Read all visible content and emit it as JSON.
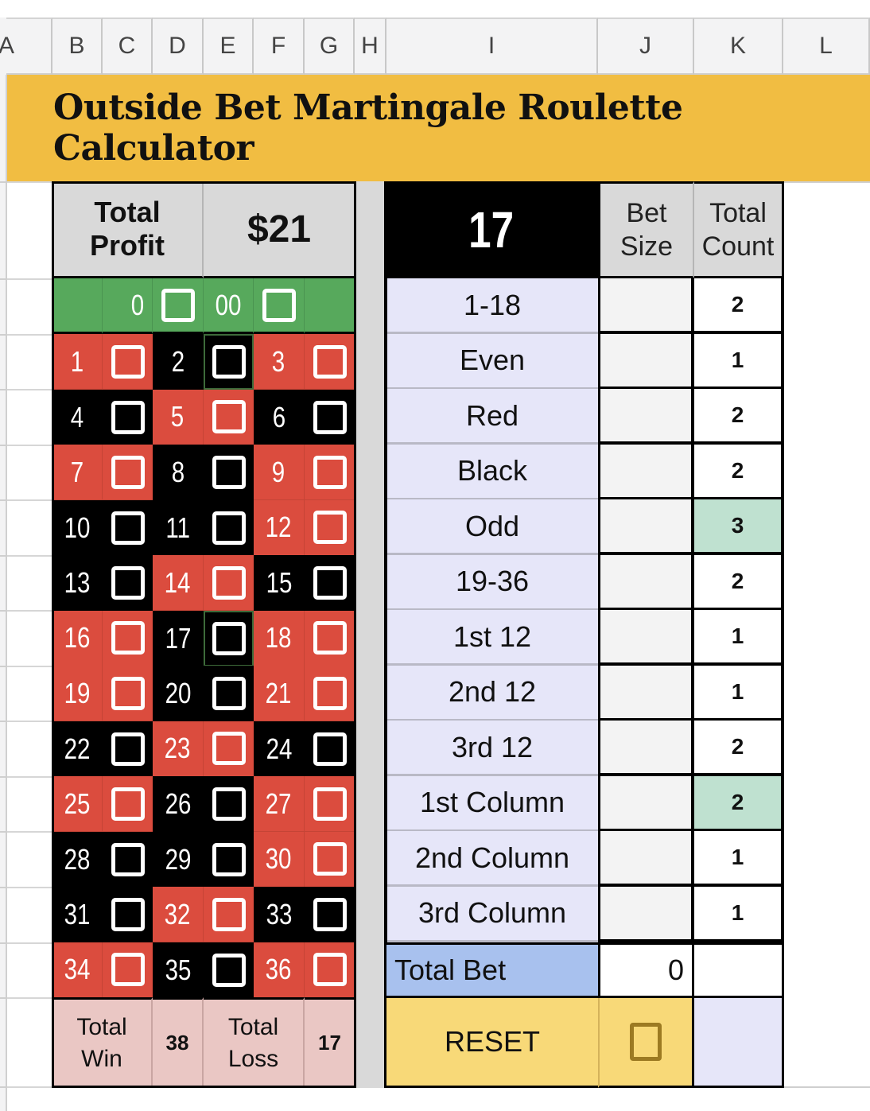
{
  "sheet": {
    "columns": [
      "A",
      "B",
      "C",
      "D",
      "E",
      "F",
      "G",
      "H",
      "I",
      "J",
      "K",
      "L"
    ]
  },
  "title": "Outside Bet Martingale Roulette Calculator",
  "profit": {
    "label": "Total Profit",
    "value": "$21"
  },
  "last_number": "17",
  "headers": {
    "bet_size": "Bet Size",
    "total_count": "Total Count"
  },
  "zero_row": {
    "zero": "0",
    "double_zero": "00"
  },
  "numbers": [
    {
      "n": "1",
      "color": "red"
    },
    {
      "n": "2",
      "color": "black"
    },
    {
      "n": "3",
      "color": "red"
    },
    {
      "n": "4",
      "color": "black"
    },
    {
      "n": "5",
      "color": "red"
    },
    {
      "n": "6",
      "color": "black"
    },
    {
      "n": "7",
      "color": "red"
    },
    {
      "n": "8",
      "color": "black"
    },
    {
      "n": "9",
      "color": "red"
    },
    {
      "n": "10",
      "color": "black"
    },
    {
      "n": "11",
      "color": "black"
    },
    {
      "n": "12",
      "color": "red"
    },
    {
      "n": "13",
      "color": "black"
    },
    {
      "n": "14",
      "color": "red"
    },
    {
      "n": "15",
      "color": "black"
    },
    {
      "n": "16",
      "color": "red"
    },
    {
      "n": "17",
      "color": "black"
    },
    {
      "n": "18",
      "color": "red"
    },
    {
      "n": "19",
      "color": "red"
    },
    {
      "n": "20",
      "color": "black"
    },
    {
      "n": "21",
      "color": "red"
    },
    {
      "n": "22",
      "color": "black"
    },
    {
      "n": "23",
      "color": "red"
    },
    {
      "n": "24",
      "color": "black"
    },
    {
      "n": "25",
      "color": "red"
    },
    {
      "n": "26",
      "color": "black"
    },
    {
      "n": "27",
      "color": "red"
    },
    {
      "n": "28",
      "color": "black"
    },
    {
      "n": "29",
      "color": "black"
    },
    {
      "n": "30",
      "color": "red"
    },
    {
      "n": "31",
      "color": "black"
    },
    {
      "n": "32",
      "color": "red"
    },
    {
      "n": "33",
      "color": "black"
    },
    {
      "n": "34",
      "color": "red"
    },
    {
      "n": "35",
      "color": "black"
    },
    {
      "n": "36",
      "color": "red"
    }
  ],
  "bets": [
    {
      "label": "1-18",
      "bet_size": "",
      "count": "2",
      "highlight": false
    },
    {
      "label": "Even",
      "bet_size": "",
      "count": "1",
      "highlight": false
    },
    {
      "label": "Red",
      "bet_size": "",
      "count": "2",
      "highlight": false
    },
    {
      "label": "Black",
      "bet_size": "",
      "count": "2",
      "highlight": false
    },
    {
      "label": "Odd",
      "bet_size": "",
      "count": "3",
      "highlight": true
    },
    {
      "label": "19-36",
      "bet_size": "",
      "count": "2",
      "highlight": false
    },
    {
      "label": "1st 12",
      "bet_size": "",
      "count": "1",
      "highlight": false
    },
    {
      "label": "2nd 12",
      "bet_size": "",
      "count": "1",
      "highlight": false
    },
    {
      "label": "3rd 12",
      "bet_size": "",
      "count": "2",
      "highlight": false
    },
    {
      "label": "1st Column",
      "bet_size": "",
      "count": "2",
      "highlight": true
    },
    {
      "label": "2nd Column",
      "bet_size": "",
      "count": "1",
      "highlight": false
    },
    {
      "label": "3rd Column",
      "bet_size": "",
      "count": "1",
      "highlight": false
    }
  ],
  "total_bet": {
    "label": "Total Bet",
    "value": "0"
  },
  "totals": {
    "win_label": "Total Win",
    "win_value": "38",
    "loss_label": "Total Loss",
    "loss_value": "17"
  },
  "reset": {
    "label": "RESET"
  },
  "colors": {
    "red": "#db4c3e",
    "black": "#000000",
    "green": "#57a95c",
    "title_bg": "#f1bd42",
    "highlight": "#bfe1d0"
  }
}
